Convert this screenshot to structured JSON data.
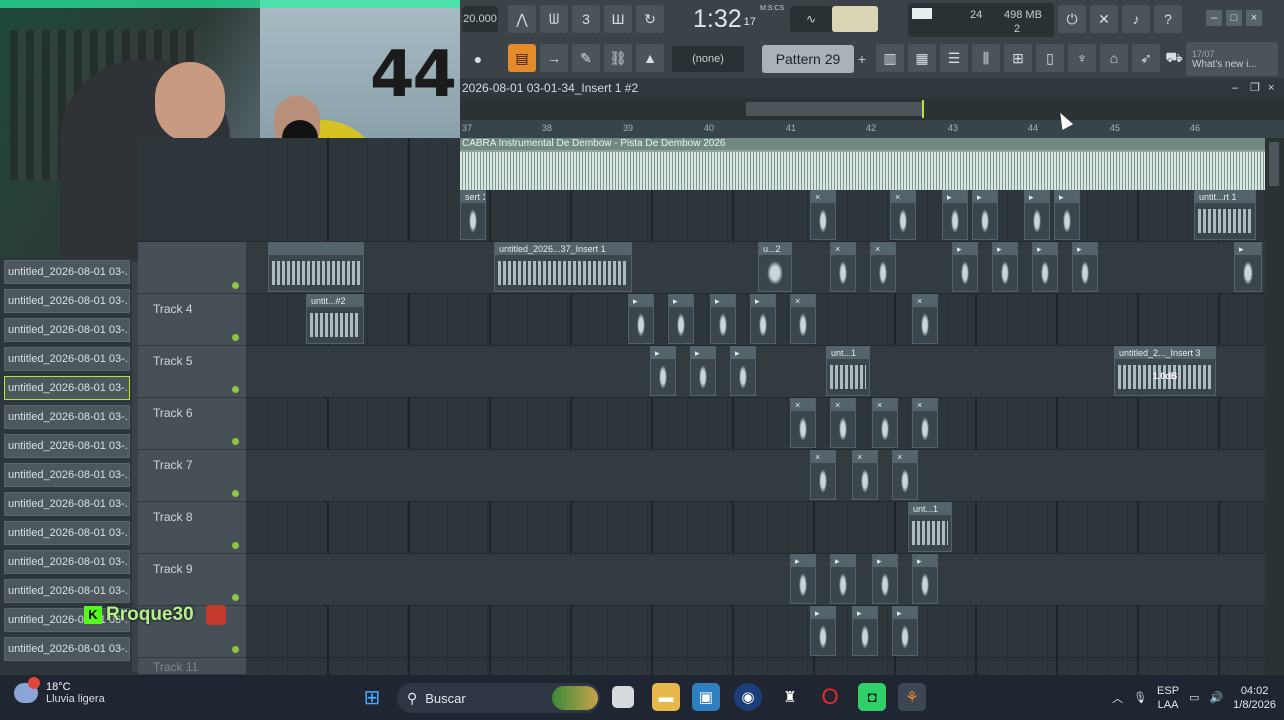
{
  "toolbar": {
    "tempo": "20.000",
    "time_main": "1:32",
    "time_sub": "17",
    "time_unit": "M:S:CS",
    "cpu_value": "24",
    "memory": "498 MB",
    "polyphony": "2",
    "pattern_none": "(none)",
    "pattern_label": "Pattern 29",
    "pattern_plus": "+",
    "news_date": "17/07",
    "news_text": "What's new i..."
  },
  "playlist": {
    "title": "2026-08-01 03-01-34_Insert 1 #2",
    "ruler": [
      "37",
      "38",
      "39",
      "40",
      "41",
      "42",
      "43",
      "44",
      "45",
      "46"
    ],
    "master_clip_title": "CABRA Instrumental De Dembow - Pista De Dembow 2026",
    "tracks": [
      {
        "name": ""
      },
      {
        "name": ""
      },
      {
        "name": "Track 4"
      },
      {
        "name": "Track 5"
      },
      {
        "name": "Track 6"
      },
      {
        "name": "Track 7"
      },
      {
        "name": "Track 8"
      },
      {
        "name": "Track 9"
      },
      {
        "name": ""
      },
      {
        "name": "Track 11"
      }
    ],
    "clips": {
      "row1_a": "sert 1",
      "row1_b": "untit...rt 1",
      "row2_a": "untitled_2026...37_Insert 1",
      "row2_b": "u...2",
      "row3_a": "untit...#2",
      "row4_a": "unt...1",
      "row4_b": "untitled_2..._Insert 3",
      "row4_b_gain": "1.0dB",
      "row7_a": "unt...1"
    }
  },
  "browser": {
    "items": [
      "untitled_2026-08-01 03-...",
      "untitled_2026-08-01 03-...",
      "untitled_2026-08-01 03-...",
      "untitled_2026-08-01 03-...",
      "untitled_2026-08-01 03-...",
      "untitled_2026-08-01 03-...",
      "untitled_2026-08-01 03-...",
      "untitled_2026-08-01 03-...",
      "untitled_2026-08-01 03-...",
      "untitled_2026-08-01 03-...",
      "untitled_2026-08-01 03-...",
      "untitled_2026-08-01 03-...",
      "untitled_2026-08-01 03-...",
      "untitled_2026-08-01 03-..."
    ]
  },
  "webcam": {
    "wall_number": "44"
  },
  "streamer": {
    "badge": "K",
    "name": "Rroque30"
  },
  "taskbar": {
    "temperature": "18°C",
    "weather": "Lluvia ligera",
    "search_label": "Buscar",
    "lang_top": "ESP",
    "lang_bottom": "LAA",
    "clock_time": "04:02",
    "clock_date": "1/8/2026"
  },
  "colors": {
    "accent_green": "#b6e33a",
    "snap_orange": "#e58b2a",
    "streamer_green": "#53fc18"
  }
}
